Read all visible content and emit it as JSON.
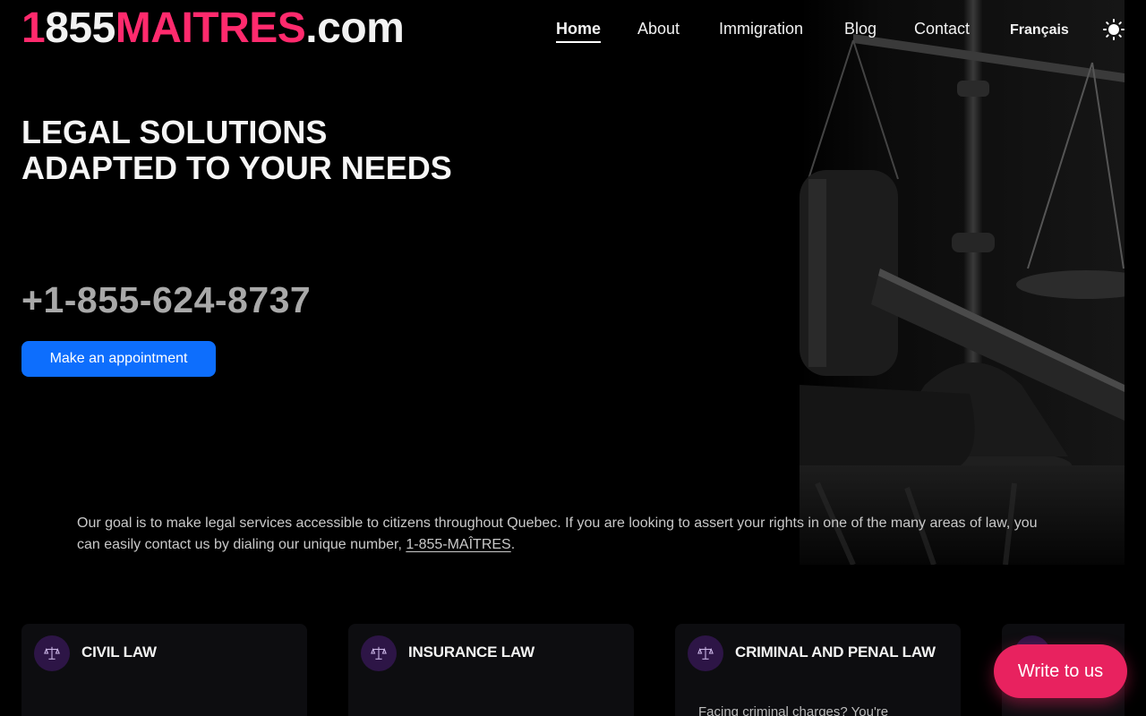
{
  "header": {
    "logo": {
      "number_first": "1",
      "number_rest": "855",
      "brand": "MAITRES",
      "tld": ".com"
    },
    "nav": [
      {
        "label": "Home",
        "active": true
      },
      {
        "label": "About"
      },
      {
        "label": "Immigration"
      },
      {
        "label": "Blog"
      },
      {
        "label": "Contact"
      }
    ],
    "language_link": "Français",
    "theme_toggle_icon": "sun-icon"
  },
  "hero": {
    "headline_line1": "LEGAL SOLUTIONS",
    "headline_line2": "ADAPTED TO YOUR NEEDS",
    "phone": "+1-855-624-8737",
    "cta_label": "Make an appointment",
    "image_icon": "scales-of-justice-gavel-image"
  },
  "intro": {
    "text_before": "Our goal is to make legal services accessible to citizens throughout Quebec. If you are looking to assert your rights in one of the many areas of law, you can easily contact us by dialing our unique number, ",
    "phone_link": "1-855-MAÎTRES",
    "text_after": "."
  },
  "practice_areas": [
    {
      "title": "CIVIL LAW",
      "icon": "scales-icon",
      "description": ""
    },
    {
      "title": "INSURANCE LAW",
      "icon": "scales-icon",
      "description": ""
    },
    {
      "title": "CRIMINAL AND PENAL LAW",
      "icon": "scales-icon",
      "description": "Facing criminal charges? You're"
    },
    {
      "title": "",
      "icon": "scales-icon",
      "description": ""
    }
  ],
  "chat": {
    "label": "Write to us"
  },
  "colors": {
    "brand_pink": "#ff2a6d",
    "cta_blue": "#0d6efd",
    "chat_pink": "#e8225f",
    "icon_purple": "#2d1546"
  }
}
